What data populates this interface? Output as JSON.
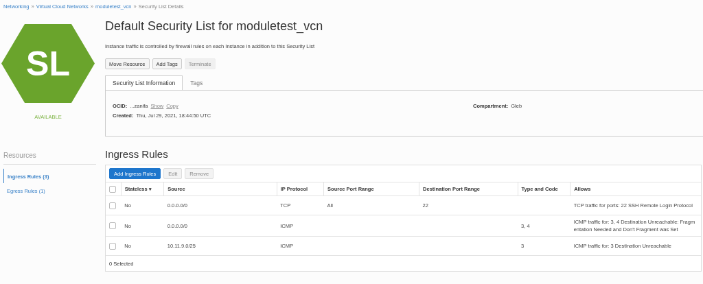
{
  "breadcrumb": {
    "separator": "»",
    "items": [
      {
        "label": "Networking",
        "kind": "link"
      },
      {
        "label": "Virtual Cloud Networks",
        "kind": "link"
      },
      {
        "label": "moduletest_vcn",
        "kind": "link"
      },
      {
        "label": "Security List Details",
        "kind": "current"
      }
    ]
  },
  "badge": {
    "initials": "SL",
    "status": "AVAILABLE"
  },
  "title": "Default Security List for moduletest_vcn",
  "description": "Instance traffic is controlled by firewall rules on each Instance in addition to this Security List",
  "actions": [
    {
      "label": "Move Resource",
      "disabled": false
    },
    {
      "label": "Add Tags",
      "disabled": false
    },
    {
      "label": "Terminate",
      "disabled": true
    }
  ],
  "tabs": [
    {
      "label": "Security List Information",
      "selected": true
    },
    {
      "label": "Tags",
      "selected": false
    }
  ],
  "info": {
    "ocid_label": "OCID:",
    "ocid": "...zanifa",
    "show": "Show",
    "copy": "Copy",
    "created_label": "Created:",
    "created": "Thu, Jul 29, 2021, 18:44:50 UTC",
    "compartment_label": "Compartment:",
    "compartment": "Gleb"
  },
  "resources": {
    "title": "Resources",
    "items": [
      {
        "label": "Ingress Rules (3)",
        "selected": true
      },
      {
        "label": "Egress Rules (1)",
        "selected": false
      }
    ]
  },
  "ingress": {
    "title": "Ingress Rules",
    "buttons": [
      {
        "label": "Add Ingress Rules",
        "kind": "primary",
        "disabled": false
      },
      {
        "label": "Edit",
        "kind": "default",
        "disabled": true
      },
      {
        "label": "Remove",
        "kind": "default",
        "disabled": true
      }
    ],
    "columns": [
      "Stateless",
      "Source",
      "IP Protocol",
      "Source Port Range",
      "Destination Port Range",
      "Type and Code",
      "Allows"
    ],
    "sort_icon": "▾",
    "select_all_checked": false,
    "rows": [
      {
        "checked": false,
        "cells": [
          "No",
          "0.0.0.0/0",
          "TCP",
          "All",
          "22",
          "",
          "TCP traffic for ports: 22 SSH Remote Login Protocol"
        ]
      },
      {
        "checked": false,
        "cells": [
          "No",
          "0.0.0.0/0",
          "ICMP",
          "",
          "",
          "3, 4",
          "ICMP traffic for: 3, 4 Destination Unreachable: Fragmentation Needed and Don't Fragment was Set"
        ]
      },
      {
        "checked": false,
        "cells": [
          "No",
          "10.11.9.0/25",
          "ICMP",
          "",
          "",
          "3",
          "ICMP traffic for: 3 Destination Unreachable"
        ]
      }
    ],
    "footer": "0 Selected"
  }
}
